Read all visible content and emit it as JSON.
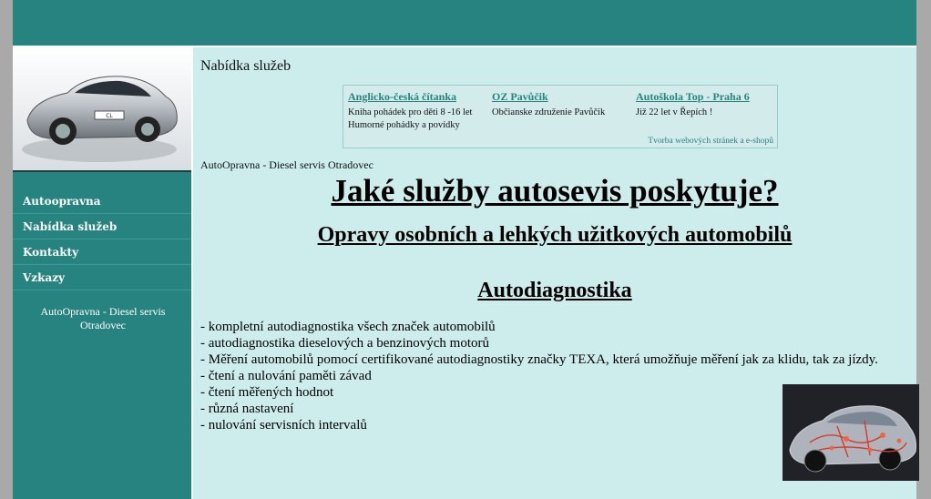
{
  "sidebar": {
    "nav": [
      "Autoopravna",
      "Nabídka služeb",
      "Kontakty",
      "Vzkazy"
    ],
    "note": "AutoOpravna - Diesel servis Otradovec"
  },
  "page": {
    "heading": "Nabídka služeb",
    "breadcrumb": "AutoOpravna - Diesel servis Otradovec"
  },
  "ads": {
    "items": [
      {
        "title": "Anglicko-česká čítanka",
        "text": "Kniha pohádek pro děti 8 -16 let Humorné pohádky a povídky"
      },
      {
        "title": "OZ Pavůčik",
        "text": "Občianske združenie Pavůčik"
      },
      {
        "title": "Autoškola Top - Praha 6",
        "text": "Již 22 let v Řepích !"
      }
    ],
    "footer": "Tvorba webových stránek a e-shopů"
  },
  "content": {
    "title": "Jaké služby autosevis poskytuje?",
    "subtitle": "Opravy osobních a lehkých užitkových automobilů",
    "section": "Autodiagnostika",
    "items": [
      "- kompletní autodiagnostika všech značek automobilů",
      "- autodiagnostika dieselových a benzinových motorů",
      "- Měření automobilů pomocí certifikované autodiagnostiky značky TEXA, která umožňuje měření  jak za klidu, tak za jízdy.",
      "- čtení a nulování paměti závad",
      "- čtení měřených hodnot",
      "- různá nastavení",
      "- nulování servisních intervalů"
    ]
  },
  "colors": {
    "teal": "#268380",
    "panel": "#cdecec",
    "link": "#268380"
  }
}
